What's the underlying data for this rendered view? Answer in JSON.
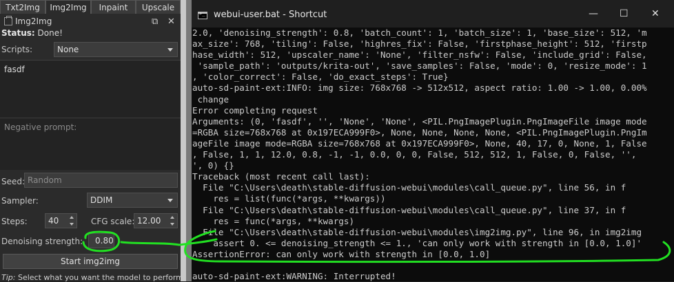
{
  "tabs": [
    {
      "label": "Txt2Img"
    },
    {
      "label": "Img2Img"
    },
    {
      "label": "Inpaint"
    },
    {
      "label": "Upscale"
    }
  ],
  "docker": {
    "title": "Img2Img",
    "status_label": "Status:",
    "status_value": "Done!"
  },
  "form": {
    "scripts_label": "Scripts:",
    "scripts_value": "None",
    "prompt": "fasdf",
    "negative_placeholder": "Negative prompt:",
    "seed_label": "Seed:",
    "seed_placeholder": "Random",
    "sampler_label": "Sampler:",
    "sampler_value": "DDIM",
    "steps_label": "Steps:",
    "steps_value": "40",
    "cfg_label": "CFG scale:",
    "cfg_value": "12.00",
    "denoise_label": "Denoising strength:",
    "denoise_value": "0.80",
    "start_button": "Start img2img",
    "tip_prefix": "Tip:",
    "tip_text": "Select what you want the model to perform"
  },
  "console": {
    "window_title": "webui-user.bat - Shortcut",
    "minimize": "—",
    "maximize": "☐",
    "close": "✕",
    "lines": [
      "2.0, 'denoising_strength': 0.8, 'batch_count': 1, 'batch_size': 1, 'base_size': 512, 'm",
      "ax_size': 768, 'tiling': False, 'highres_fix': False, 'firstphase_height': 512, 'firstp",
      "hase_width': 512, 'upscaler_name': 'None', 'filter_nsfw': False, 'include_grid': False,",
      " 'sample_path': 'outputs/krita-out', 'save_samples': False, 'mode': 0, 'resize_mode': 1",
      ", 'color_correct': False, 'do_exact_steps': True}",
      "auto-sd-paint-ext:INFO: img size: 768x768 -> 512x512, aspect ratio: 1.00 -> 1.00, 0.00%",
      " change",
      "Error completing request",
      "Arguments: (0, 'fasdf', '', 'None', 'None', <PIL.PngImagePlugin.PngImageFile image mode",
      "=RGBA size=768x768 at 0x197ECA999F0>, None, None, None, None, <PIL.PngImagePlugin.PngIm",
      "ageFile image mode=RGBA size=768x768 at 0x197ECA999F0>, None, 40, 17, 0, None, 1, False",
      ", False, 1, 1, 12.0, 0.8, -1, -1, 0.0, 0, 0, False, 512, 512, 1, False, 0, False, '',",
      "', 0) {}",
      "Traceback (most recent call last):",
      "  File \"C:\\Users\\death\\stable-diffusion-webui\\modules\\call_queue.py\", line 56, in f",
      "    res = list(func(*args, **kwargs))",
      "  File \"C:\\Users\\death\\stable-diffusion-webui\\modules\\call_queue.py\", line 37, in f",
      "    res = func(*args, **kwargs)",
      "  File \"C:\\Users\\death\\stable-diffusion-webui\\modules\\img2img.py\", line 96, in img2img",
      "    assert 0. <= denoising_strength <= 1., 'can only work with strength in [0.0, 1.0]'",
      "AssertionError: can only work with strength in [0.0, 1.0]",
      "",
      "auto-sd-paint-ext:WARNING: Interrupted!"
    ]
  },
  "colors": {
    "annotation": "#22e022"
  }
}
